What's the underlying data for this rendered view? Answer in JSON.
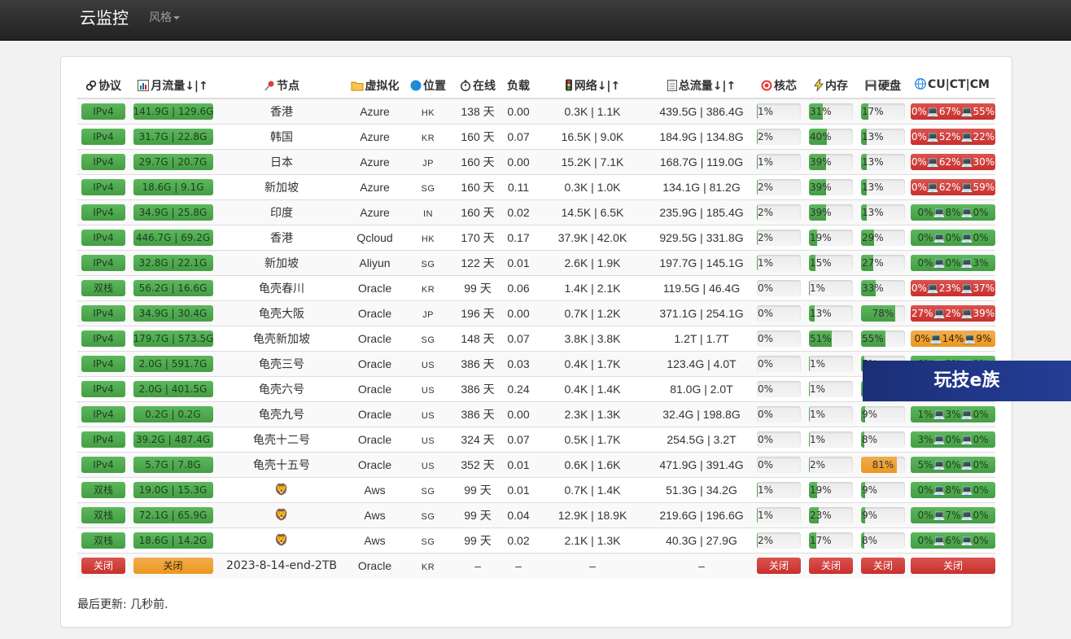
{
  "navbar": {
    "brand": "云监控",
    "style_menu": "风格"
  },
  "table": {
    "headers": {
      "protocol": "协议",
      "month_traffic": "月流量↓|↑",
      "node": "节点",
      "virt": "虚拟化",
      "location": "位置",
      "uptime": "在线",
      "load": "负载",
      "network": "网络↓|↑",
      "total_traffic": "总流量↓|↑",
      "cpu": "核芯",
      "memory": "内存",
      "disk": "硬盘",
      "isp": "CU|CT|CM"
    },
    "rows": [
      {
        "protocol": "IPv4",
        "month": "141.9G | 129.6G",
        "node": "香港",
        "virt": "Azure",
        "loc": "HK",
        "uptime": "138 天",
        "load": "0.00",
        "net": "0.3K | 1.1K",
        "total": "439.5G | 386.4G",
        "cpu": "1%",
        "cpu_v": 1,
        "mem": "31%",
        "mem_v": 31,
        "disk": "17%",
        "disk_v": 17,
        "isp": "0%💻67%💻55%",
        "isp_color": "red"
      },
      {
        "protocol": "IPv4",
        "month": "31.7G | 22.8G",
        "node": "韩国",
        "virt": "Azure",
        "loc": "KR",
        "uptime": "160 天",
        "load": "0.07",
        "net": "16.5K | 9.0K",
        "total": "184.9G | 134.8G",
        "cpu": "2%",
        "cpu_v": 2,
        "mem": "40%",
        "mem_v": 40,
        "disk": "13%",
        "disk_v": 13,
        "isp": "0%💻52%💻22%",
        "isp_color": "red"
      },
      {
        "protocol": "IPv4",
        "month": "29.7G | 20.7G",
        "node": "日本",
        "virt": "Azure",
        "loc": "JP",
        "uptime": "160 天",
        "load": "0.00",
        "net": "15.2K | 7.1K",
        "total": "168.7G | 119.0G",
        "cpu": "1%",
        "cpu_v": 1,
        "mem": "39%",
        "mem_v": 39,
        "disk": "13%",
        "disk_v": 13,
        "isp": "0%💻62%💻30%",
        "isp_color": "red"
      },
      {
        "protocol": "IPv4",
        "month": "18.6G | 9.1G",
        "node": "新加坡",
        "virt": "Azure",
        "loc": "SG",
        "uptime": "160 天",
        "load": "0.11",
        "net": "0.3K | 1.0K",
        "total": "134.1G | 81.2G",
        "cpu": "2%",
        "cpu_v": 2,
        "mem": "39%",
        "mem_v": 39,
        "disk": "13%",
        "disk_v": 13,
        "isp": "0%💻62%💻59%",
        "isp_color": "red"
      },
      {
        "protocol": "IPv4",
        "month": "34.9G | 25.8G",
        "node": "印度",
        "virt": "Azure",
        "loc": "IN",
        "uptime": "160 天",
        "load": "0.02",
        "net": "14.5K | 6.5K",
        "total": "235.9G | 185.4G",
        "cpu": "2%",
        "cpu_v": 2,
        "mem": "39%",
        "mem_v": 39,
        "disk": "13%",
        "disk_v": 13,
        "isp": "0%💻8%💻0%",
        "isp_color": "green"
      },
      {
        "protocol": "IPv4",
        "month": "446.7G | 69.2G",
        "node": "香港",
        "virt": "Qcloud",
        "loc": "HK",
        "uptime": "170 天",
        "load": "0.17",
        "net": "37.9K | 42.0K",
        "total": "929.5G | 331.8G",
        "cpu": "2%",
        "cpu_v": 2,
        "mem": "19%",
        "mem_v": 19,
        "disk": "29%",
        "disk_v": 29,
        "isp": "0%💻0%💻0%",
        "isp_color": "green"
      },
      {
        "protocol": "IPv4",
        "month": "32.8G | 22.1G",
        "node": "新加坡",
        "virt": "Aliyun",
        "loc": "SG",
        "uptime": "122 天",
        "load": "0.01",
        "net": "2.6K | 1.9K",
        "total": "197.7G | 145.1G",
        "cpu": "1%",
        "cpu_v": 1,
        "mem": "15%",
        "mem_v": 15,
        "disk": "27%",
        "disk_v": 27,
        "isp": "0%💻0%💻3%",
        "isp_color": "green"
      },
      {
        "protocol": "双栈",
        "month": "56.2G | 16.6G",
        "node": "龟壳春川",
        "virt": "Oracle",
        "loc": "KR",
        "uptime": "99 天",
        "load": "0.06",
        "net": "1.4K | 2.1K",
        "total": "119.5G | 46.4G",
        "cpu": "0%",
        "cpu_v": 0,
        "mem": "1%",
        "mem_v": 1,
        "disk": "33%",
        "disk_v": 33,
        "isp": "0%💻23%💻37%",
        "isp_color": "red"
      },
      {
        "protocol": "IPv4",
        "month": "34.9G | 30.4G",
        "node": "龟壳大阪",
        "virt": "Oracle",
        "loc": "JP",
        "uptime": "196 天",
        "load": "0.00",
        "net": "0.7K | 1.2K",
        "total": "371.1G | 254.1G",
        "cpu": "0%",
        "cpu_v": 0,
        "mem": "13%",
        "mem_v": 13,
        "disk": "78%",
        "disk_v": 78,
        "isp": "27%💻2%💻39%",
        "isp_color": "red"
      },
      {
        "protocol": "IPv4",
        "month": "179.7G | 573.5G",
        "node": "龟壳新加坡",
        "virt": "Oracle",
        "loc": "SG",
        "uptime": "148 天",
        "load": "0.07",
        "net": "3.8K | 3.8K",
        "total": "1.2T | 1.7T",
        "cpu": "0%",
        "cpu_v": 0,
        "mem": "51%",
        "mem_v": 51,
        "disk": "55%",
        "disk_v": 55,
        "isp": "0%💻14%💻9%",
        "isp_color": "orange"
      },
      {
        "protocol": "IPv4",
        "month": "2.0G | 591.7G",
        "node": "龟壳三号",
        "virt": "Oracle",
        "loc": "US",
        "uptime": "386 天",
        "load": "0.03",
        "net": "0.4K | 1.7K",
        "total": "123.4G | 4.0T",
        "cpu": "0%",
        "cpu_v": 0,
        "mem": "1%",
        "mem_v": 1,
        "disk": "7%",
        "disk_v": 7,
        "isp": "0%💻0%💻0%",
        "isp_color": "green"
      },
      {
        "protocol": "IPv4",
        "month": "2.0G | 401.5G",
        "node": "龟壳六号",
        "virt": "Oracle",
        "loc": "US",
        "uptime": "386 天",
        "load": "0.24",
        "net": "0.4K | 1.4K",
        "total": "81.0G | 2.0T",
        "cpu": "0%",
        "cpu_v": 0,
        "mem": "1%",
        "mem_v": 1,
        "disk": "7%",
        "disk_v": 7,
        "isp": "0%💻0%💻0%",
        "isp_color": "green"
      },
      {
        "protocol": "IPv4",
        "month": "0.2G | 0.2G",
        "node": "龟壳九号",
        "virt": "Oracle",
        "loc": "US",
        "uptime": "386 天",
        "load": "0.00",
        "net": "2.3K | 1.3K",
        "total": "32.4G | 198.8G",
        "cpu": "0%",
        "cpu_v": 0,
        "mem": "1%",
        "mem_v": 1,
        "disk": "9%",
        "disk_v": 9,
        "isp": "1%💻3%💻0%",
        "isp_color": "green"
      },
      {
        "protocol": "IPv4",
        "month": "39.2G | 487.4G",
        "node": "龟壳十二号",
        "virt": "Oracle",
        "loc": "US",
        "uptime": "324 天",
        "load": "0.07",
        "net": "0.5K | 1.7K",
        "total": "254.5G | 3.2T",
        "cpu": "0%",
        "cpu_v": 0,
        "mem": "1%",
        "mem_v": 1,
        "disk": "8%",
        "disk_v": 8,
        "isp": "3%💻0%💻0%",
        "isp_color": "green"
      },
      {
        "protocol": "IPv4",
        "month": "5.7G | 7.8G",
        "node": "龟壳十五号",
        "virt": "Oracle",
        "loc": "US",
        "uptime": "352 天",
        "load": "0.01",
        "net": "0.6K | 1.6K",
        "total": "471.9G | 391.4G",
        "cpu": "0%",
        "cpu_v": 0,
        "mem": "2%",
        "mem_v": 2,
        "disk": "81%",
        "disk_v": 81,
        "isp": "5%💻0%💻0%",
        "isp_color": "green"
      },
      {
        "protocol": "双栈",
        "month": "19.0G | 15.3G",
        "node": "🦁",
        "virt": "Aws",
        "loc": "SG",
        "uptime": "99 天",
        "load": "0.01",
        "net": "0.7K | 1.4K",
        "total": "51.3G | 34.2G",
        "cpu": "1%",
        "cpu_v": 1,
        "mem": "19%",
        "mem_v": 19,
        "disk": "9%",
        "disk_v": 9,
        "isp": "0%💻8%💻0%",
        "isp_color": "green"
      },
      {
        "protocol": "双栈",
        "month": "72.1G | 65.9G",
        "node": "🦁",
        "virt": "Aws",
        "loc": "SG",
        "uptime": "99 天",
        "load": "0.04",
        "net": "12.9K | 18.9K",
        "total": "219.6G | 196.6G",
        "cpu": "1%",
        "cpu_v": 1,
        "mem": "23%",
        "mem_v": 23,
        "disk": "9%",
        "disk_v": 9,
        "isp": "0%💻7%💻0%",
        "isp_color": "green"
      },
      {
        "protocol": "双栈",
        "month": "18.6G | 14.2G",
        "node": "🦁",
        "virt": "Aws",
        "loc": "SG",
        "uptime": "99 天",
        "load": "0.02",
        "net": "2.1K | 1.3K",
        "total": "40.3G | 27.9G",
        "cpu": "2%",
        "cpu_v": 2,
        "mem": "17%",
        "mem_v": 17,
        "disk": "8%",
        "disk_v": 8,
        "isp": "0%💻6%💻0%",
        "isp_color": "green"
      }
    ],
    "offline_row": {
      "protocol": "关闭",
      "month": "关闭",
      "node": "2023-8-14-end-2TB",
      "virt": "Oracle",
      "loc": "KR",
      "uptime": "–",
      "load": "–",
      "net": "–",
      "total": "–",
      "cpu": "关闭",
      "mem": "关闭",
      "disk": "关闭",
      "isp": "关闭"
    }
  },
  "footer": {
    "last_update": "最后更新: 几秒前."
  },
  "watermark": {
    "text": "玩技e族"
  },
  "colors": {
    "green": "#5cb85c",
    "red": "#d9534f",
    "orange": "#f0ad4e",
    "navbar": "#222222"
  },
  "header_icons": [
    "link-icon",
    "bar-chart-icon",
    "pin-icon",
    "folder-icon",
    "globe-icon",
    "stopwatch-icon",
    "none",
    "traffic-light-icon",
    "clipboard-icon",
    "target-icon",
    "lightning-icon",
    "floppy-icon",
    "globe-icon"
  ]
}
